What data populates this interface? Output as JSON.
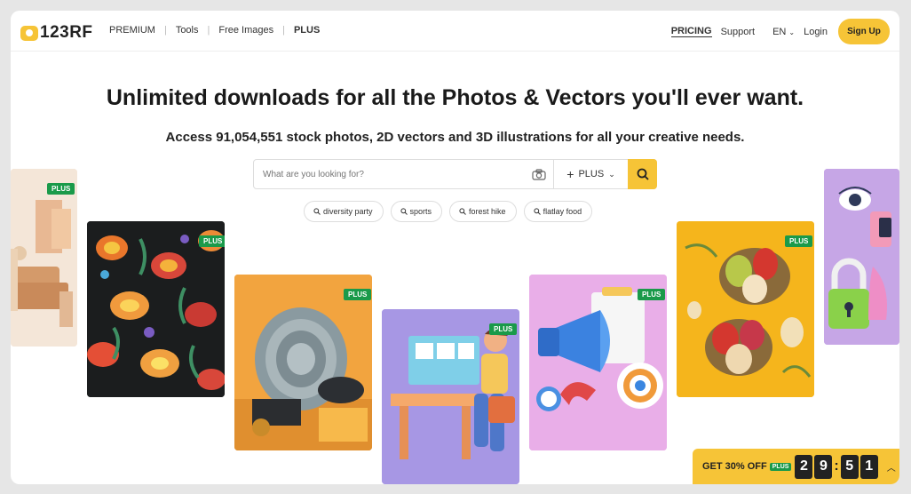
{
  "header": {
    "logo": "123RF",
    "nav": [
      "PREMIUM",
      "Tools",
      "Free Images",
      "PLUS"
    ],
    "pricing": "PRICING",
    "support": "Support",
    "language": "EN",
    "login": "Login",
    "signup": "Sign Up"
  },
  "hero": {
    "headline": "Unlimited downloads for all the Photos & Vectors you'll ever want.",
    "subheadline": "Access 91,054,551 stock photos, 2D vectors and 3D illustrations for all your creative needs."
  },
  "search": {
    "placeholder": "What are you looking for?",
    "scope": "PLUS"
  },
  "suggestions": [
    "diversity party",
    "sports",
    "forest hike",
    "flatlay food"
  ],
  "badge_label": "PLUS",
  "promo": {
    "text": "GET 30% OFF",
    "badge": "PLUS",
    "digits": [
      "2",
      "9",
      "5",
      "1"
    ]
  },
  "colors": {
    "accent": "#f6c437",
    "badge_green": "#1a9a4a"
  }
}
